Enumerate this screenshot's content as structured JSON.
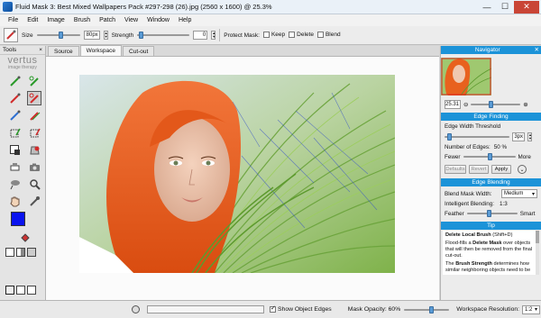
{
  "window": {
    "title": "Fluid Mask 3: Best Mixed Wallpapers Pack #297-298 (26).jpg (2560 x 1600) @ 25.3%",
    "minimize": "—",
    "maximize": "☐",
    "close": "✕"
  },
  "menu": [
    "File",
    "Edit",
    "Image",
    "Brush",
    "Patch",
    "View",
    "Window",
    "Help"
  ],
  "options": {
    "size_label": "Size",
    "size_value": "80px",
    "strength_label": "Strength",
    "strength_value": "0",
    "protect_mask_label": "Protect Mask:",
    "keep_label": "Keep",
    "delete_label": "Delete",
    "blend_label": "Blend"
  },
  "tools": {
    "title": "Tools",
    "close": "×",
    "logo_main": "vertus",
    "logo_sub": "image therapy",
    "fg_color": "#0a13f0",
    "bg_color": "#ffffff",
    "grid_icons": [
      "keep-brush-icon",
      "keep-local-brush-icon",
      "delete-brush-icon",
      "delete-local-brush-icon",
      "blend-brush-icon",
      "blend-local-brush-icon",
      "patch-icon",
      "patch-brush-icon",
      "fill-keep-icon",
      "fill-delete-icon",
      "eraser-icon",
      "camera-icon",
      "lasso-icon",
      "zoom-icon",
      "hand-icon",
      "eyedropper-icon"
    ]
  },
  "tabs": [
    {
      "label": "Source",
      "active": false
    },
    {
      "label": "Workspace",
      "active": true
    },
    {
      "label": "Cut-out",
      "active": false
    }
  ],
  "navigator": {
    "title": "Navigator",
    "zoom_value": "25.31"
  },
  "edge_finding": {
    "title": "Edge Finding",
    "threshold_label": "Edge Width Threshold",
    "threshold_value": "3px",
    "num_edges_label": "Number of Edges:",
    "num_edges_value": "50 %",
    "fewer_label": "Fewer",
    "more_label": "More",
    "defaults_label": "Defaults",
    "revert_label": "Revert",
    "apply_label": "Apply"
  },
  "edge_blending": {
    "title": "Edge Blending",
    "mask_width_label": "Blend Mask Width:",
    "mask_width_value": "Medium",
    "intelligent_label": "Intelligent Blending:",
    "intelligent_value": "1:3",
    "feather_label": "Feather",
    "smart_label": "Smart"
  },
  "tip": {
    "title": "Tip",
    "heading": "Delete Local Brush",
    "shortcut": "(Shift+D)",
    "line1_bold": "Flood-fills a ",
    "line1_strong": "Delete Mask",
    "line1_rest": " over objects that will then be removed from the final cut-out.",
    "line2_pre": "The ",
    "line2_strong": "Brush Strength",
    "line2_rest": " determines how similar neighboring objects need to be"
  },
  "status": {
    "show_edges_label": "Show Object Edges",
    "mask_opacity_label": "Mask Opacity: 60%",
    "mask_opacity": 0.6,
    "workspace_res_label": "Workspace Resolution:",
    "workspace_res_value": "1:2"
  },
  "colors": {
    "accent": "#1c93d8",
    "hair": "#ec5b1a",
    "grass": "#7fb24a"
  }
}
